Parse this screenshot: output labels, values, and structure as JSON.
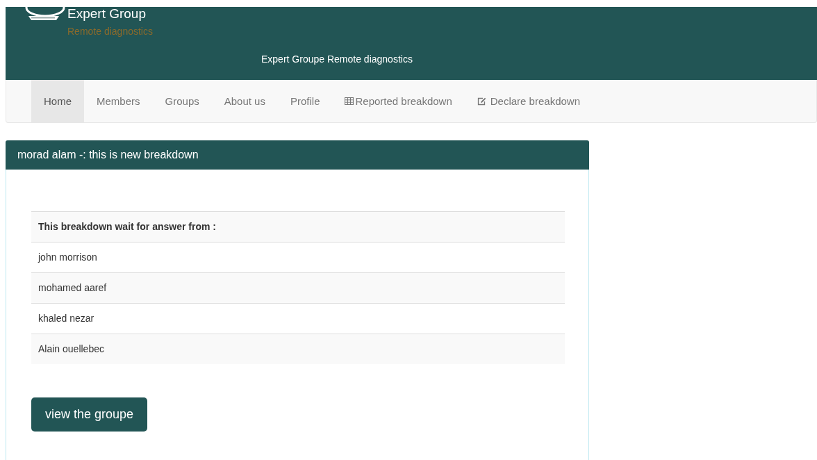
{
  "header": {
    "brand": "Expert Group",
    "tagline": "Remote diagnostics",
    "subtitle": "Expert Groupe Remote diagnostics"
  },
  "nav": [
    {
      "label": "Home",
      "selected": true,
      "kind": "plain"
    },
    {
      "label": "Members",
      "selected": false,
      "kind": "plain"
    },
    {
      "label": "Groups",
      "selected": false,
      "kind": "plain"
    },
    {
      "label": "About us",
      "selected": false,
      "kind": "plain"
    },
    {
      "label": "Profile",
      "selected": false,
      "kind": "plain"
    },
    {
      "label": "Reported breakdown",
      "selected": false,
      "kind": "grid"
    },
    {
      "label": "Declare breakdown",
      "selected": false,
      "kind": "note"
    }
  ],
  "panel": {
    "title": "morad alam -: this is new breakdown",
    "table": {
      "heading": "This breakdown wait for answer from :",
      "rows": [
        "john morrison",
        "mohamed aaref",
        "khaled nezar",
        "Alain ouellebec"
      ]
    },
    "button": "view the groupe"
  }
}
